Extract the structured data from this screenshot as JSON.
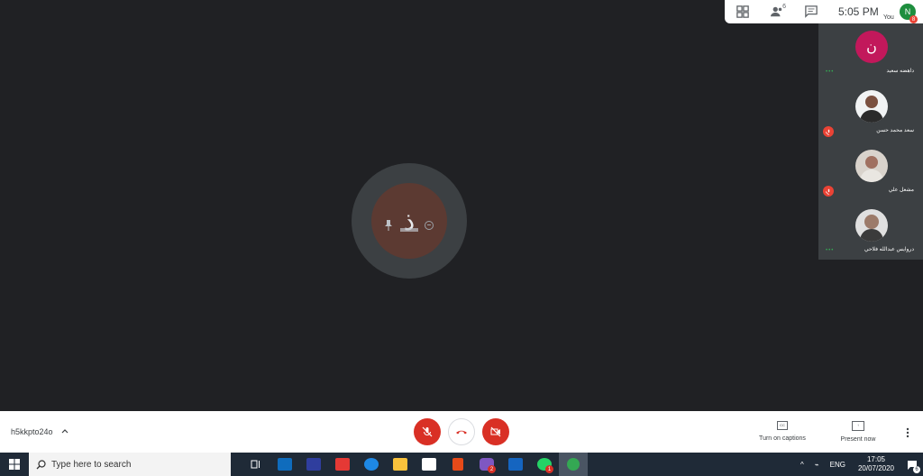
{
  "topbar": {
    "people_count": "6",
    "time": "5:05 PM",
    "you_label": "You",
    "you_initial": "N",
    "you_badge": "8"
  },
  "participants": [
    {
      "name": "داهضه سعيد",
      "initial": "ن",
      "status": "speaking",
      "avatar_color": "#c2185b"
    },
    {
      "name": "سعد محمد حسن",
      "initial": "",
      "status": "muted"
    },
    {
      "name": "مشعل علي",
      "initial": "",
      "status": "muted"
    },
    {
      "name": "دروايس عبدالله فلاحي",
      "initial": "",
      "status": "speaking"
    }
  ],
  "center": {
    "initial": "ذ",
    "ring_color": "#5c3a32"
  },
  "controls": {
    "meeting_code": "h5kkpto24o",
    "captions_label": "Turn on captions",
    "present_label": "Present now",
    "danger_color": "#d93025"
  },
  "taskbar": {
    "search_placeholder": "Type here to search",
    "language": "ENG",
    "time": "17:05",
    "date": "20/07/2020",
    "notif_count": "6",
    "viber_badge": "2",
    "whatsapp_badge": "1"
  }
}
